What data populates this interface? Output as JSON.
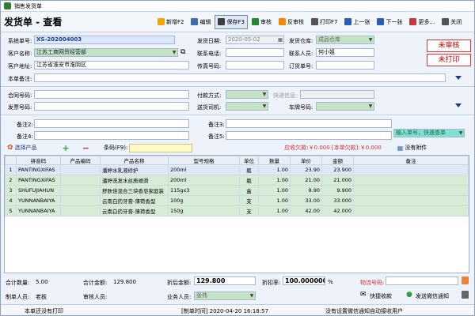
{
  "window": {
    "title": "销售发货单"
  },
  "toolbar": {
    "doc_title": "发货单 - 查看",
    "buttons": [
      {
        "label": "新增F2",
        "color": "#f0a400"
      },
      {
        "label": "编辑",
        "color": "#3d6fb0"
      },
      {
        "label": "保存F3",
        "color": "#3c3c3c"
      },
      {
        "label": "审核",
        "color": "#1f8a2e"
      },
      {
        "label": "反审核",
        "color": "#f08a00"
      },
      {
        "label": "打印F7",
        "color": "#555555"
      },
      {
        "label": "上一张",
        "color": "#2b5fb7"
      },
      {
        "label": "下一张",
        "color": "#2b5fb7"
      },
      {
        "label": "更多...",
        "color": "#c23a3a"
      },
      {
        "label": "关闭",
        "color": "#555555"
      }
    ]
  },
  "form": {
    "sys_no_label": "系统单号:",
    "sys_no": "XS-202004003",
    "ship_date_label": "发货日期:",
    "ship_date": "2020-05-02",
    "warehouse_label": "发货仓库:",
    "warehouse": "成品仓库",
    "customer_label": "客户名称:",
    "customer": "江苏工商网贸经营部",
    "contact_phone_label": "联系电话:",
    "contact_phone": "",
    "contact_label": "联系人员:",
    "contact": "何小姐",
    "address_label": "客户地址:",
    "address": "江苏省淮安市淮阴区",
    "fax_label": "传真号码:",
    "fax": "",
    "order_no_label": "订货单号:",
    "order_no": "",
    "remark_label": "本单备注:",
    "remark": "",
    "contract_label": "合同号码:",
    "contract": "",
    "pay_label": "付款方式:",
    "pay": "",
    "express_label": "快递信息:",
    "express": "",
    "invoice_label": "发票号码:",
    "invoice": "",
    "driver_label": "送货司机:",
    "driver": "",
    "plate_label": "车牌号码:",
    "plate": "",
    "remark2_label": "备注2:",
    "remark3_label": "备注3:",
    "remark4_label": "备注4:",
    "remark5_label": "备注5:",
    "remark2": "",
    "remark3": "",
    "remark4": "",
    "remark5": "",
    "quick_input_placeholder": "输入单号，快速查单",
    "stamp_unaudited": "未审核",
    "stamp_unprinted": "未打印"
  },
  "productbar": {
    "select_label": "选择产品",
    "barcode_label": "条码(F9):",
    "barcode": "",
    "receivable": "应收欠款:￥0.000 [本单欠款]:￥0.000",
    "attachment": "没有附件"
  },
  "table": {
    "headers": [
      "",
      "拼音码",
      "产品编码",
      "产品名称",
      "型号规格",
      "单位",
      "数量",
      "单价",
      "金额",
      "备注"
    ],
    "rows": [
      [
        "1",
        "PANTINGXIFAS",
        "",
        "潘婷水乳液修护",
        "200ml",
        "瓶",
        "1.00",
        "23.90",
        "23.900",
        ""
      ],
      [
        "2",
        "PANTINGXIFAS",
        "",
        "潘婷洗发水丝质顺滑",
        "200ml",
        "瓶",
        "1.00",
        "21.00",
        "21.000",
        ""
      ],
      [
        "3",
        "SHUFUJIAHUN",
        "",
        "舒肤佳混合三块香皂家庭装",
        "115gx3",
        "盒",
        "1.00",
        "9.90",
        "9.900",
        ""
      ],
      [
        "4",
        "YUNNANBAIYA",
        "",
        "云南白药牙膏-薄荷香型",
        "100g",
        "支",
        "1.00",
        "33.00",
        "33.000",
        ""
      ],
      [
        "5",
        "YUNNANBAIYA",
        "",
        "云南白药牙膏-薄荷香型",
        "150g",
        "支",
        "1.00",
        "42.00",
        "42.000",
        ""
      ]
    ]
  },
  "footer": {
    "total_qty_label": "合计数量:",
    "total_qty": "5.00",
    "total_amount_label": "合计金额:",
    "total_amount": "129.800",
    "discount_amount_label": "折后金额:",
    "discount_amount": "129.800",
    "discount_rate_label": "折扣率:",
    "discount_rate": "100.000000",
    "percent": "%",
    "tracking_label": "物流号码:",
    "tracking": "",
    "maker_label": "制单人员:",
    "maker": "老板",
    "auditor_label": "审核人员:",
    "auditor": "",
    "sales_label": "业务人员:",
    "sales": "张伟",
    "quick_receive": "快捷收款",
    "wechat_notify": "发送微信通知"
  },
  "status": {
    "left": "本单还没有打印",
    "middle": "[制单时间] 2020-04-20 16:18:57",
    "right": "没有设置微信通知自动接收用户"
  }
}
